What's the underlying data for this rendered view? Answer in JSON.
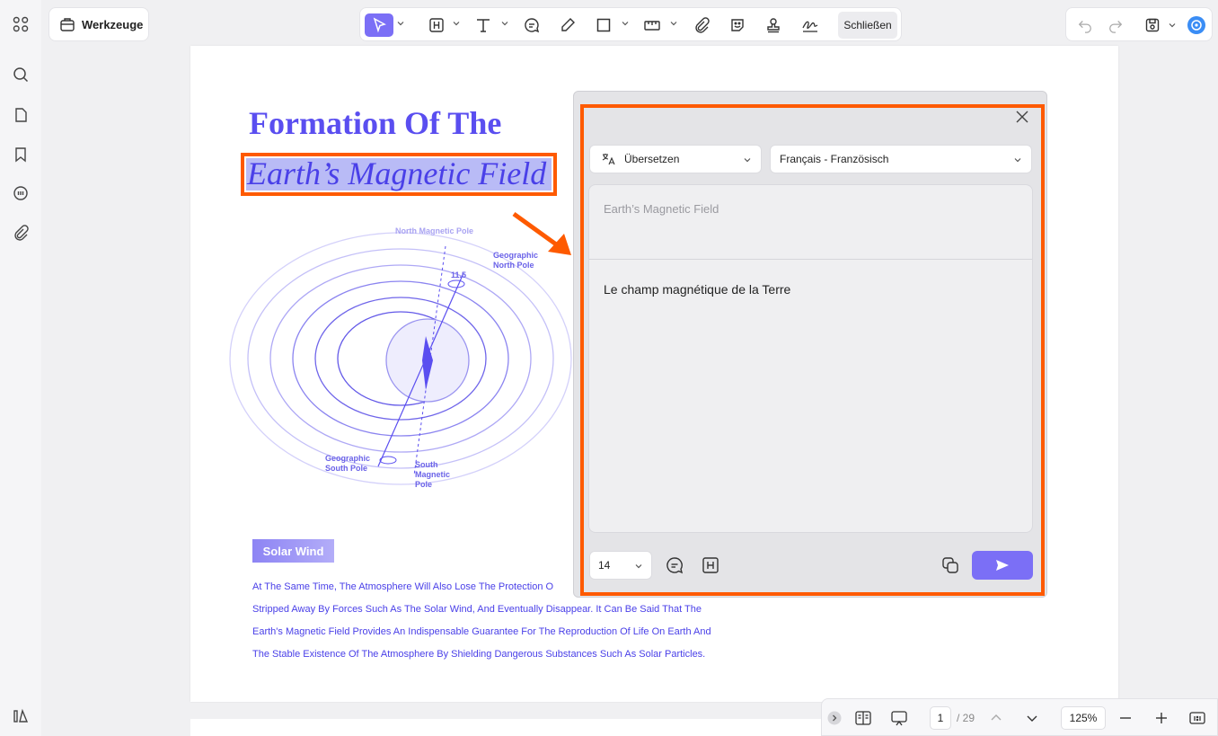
{
  "toolbar": {
    "tools_label": "Werkzeuge",
    "close_label": "Schließen"
  },
  "document": {
    "title": "Formation Of The",
    "subtitle": "Earth’s Magnetic Field",
    "diagram_labels": {
      "north_magnetic": "North Magnetic Pole",
      "geographic_north": "Geographic North Pole",
      "angle": "11.5",
      "geographic_south": "Geographic South Pole",
      "south_magnetic": "South Magnetic Pole"
    },
    "section_badge": "Solar Wind",
    "paragraph_lines": [
      "At The Same Time, The Atmosphere Will Also Lose The Protection O",
      "Stripped Away By Forces Such As The Solar Wind, And Eventually Disappear. It Can Be Said That The",
      "Earth's Magnetic Field Provides An Indispensable Guarantee For The Reproduction Of Life On Earth And",
      "The Stable Existence Of The Atmosphere By Shielding Dangerous Substances Such As Solar Particles."
    ]
  },
  "translate_panel": {
    "mode_label": "Übersetzen",
    "language_label": "Français - Französisch",
    "source_text": "Earth’s Magnetic Field",
    "translated_text": "Le champ magnétique de la Terre",
    "font_size": "14"
  },
  "bottom_bar": {
    "current_page": "1",
    "total_pages": "/ 29",
    "zoom": "125%"
  },
  "colors": {
    "accent": "#7b6ff6",
    "highlight_outline": "#fe5a00",
    "doc_text": "#4a40e8"
  }
}
